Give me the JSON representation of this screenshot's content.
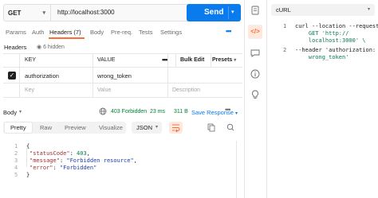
{
  "request": {
    "method": "GET",
    "url": "http://localhost:3000",
    "send_label": "Send"
  },
  "tabs": [
    {
      "label": "Params"
    },
    {
      "label": "Auth"
    },
    {
      "label": "Headers (7)"
    },
    {
      "label": "Body"
    },
    {
      "label": "Pre-req."
    },
    {
      "label": "Tests"
    },
    {
      "label": "Settings"
    }
  ],
  "headers_section": {
    "title": "Headers",
    "hidden": "6 hidden"
  },
  "table": {
    "columns": [
      "KEY",
      "VALUE"
    ],
    "bulk_edit": "Bulk Edit",
    "presets": "Presets",
    "rows": [
      {
        "key": "authorization",
        "value": "wrong_token",
        "checked": true
      }
    ],
    "placeholder": {
      "key": "Key",
      "value": "Value",
      "description": "Description"
    }
  },
  "response": {
    "body_label": "Body",
    "status": "403 Forbidden",
    "time": "23 ms",
    "size": "311 B",
    "save_label": "Save Response",
    "views": [
      "Pretty",
      "Raw",
      "Preview",
      "Visualize"
    ],
    "format": "JSON",
    "lines": [
      "1",
      "2",
      "3",
      "4",
      "5"
    ],
    "json": {
      "open": "{",
      "k1": "\"statusCode\"",
      "v1": "403",
      "k2": "\"message\"",
      "v2": "\"Forbidden resource\"",
      "k3": "\"error\"",
      "v3": "\"Forbidden\"",
      "close": "}"
    }
  },
  "snippet": {
    "language": "cURL",
    "line1_num": "1",
    "line2_num": "2",
    "line1a": "curl --location --request",
    "line1b": "    GET 'http://",
    "line1c": "    localhost:3000' \\",
    "line2a": "--header 'authorization:",
    "line2b": "    wrong_token'"
  },
  "colors": {
    "send": "#097bed",
    "accent": "#ff6c37",
    "status_ok": "#007f31"
  }
}
